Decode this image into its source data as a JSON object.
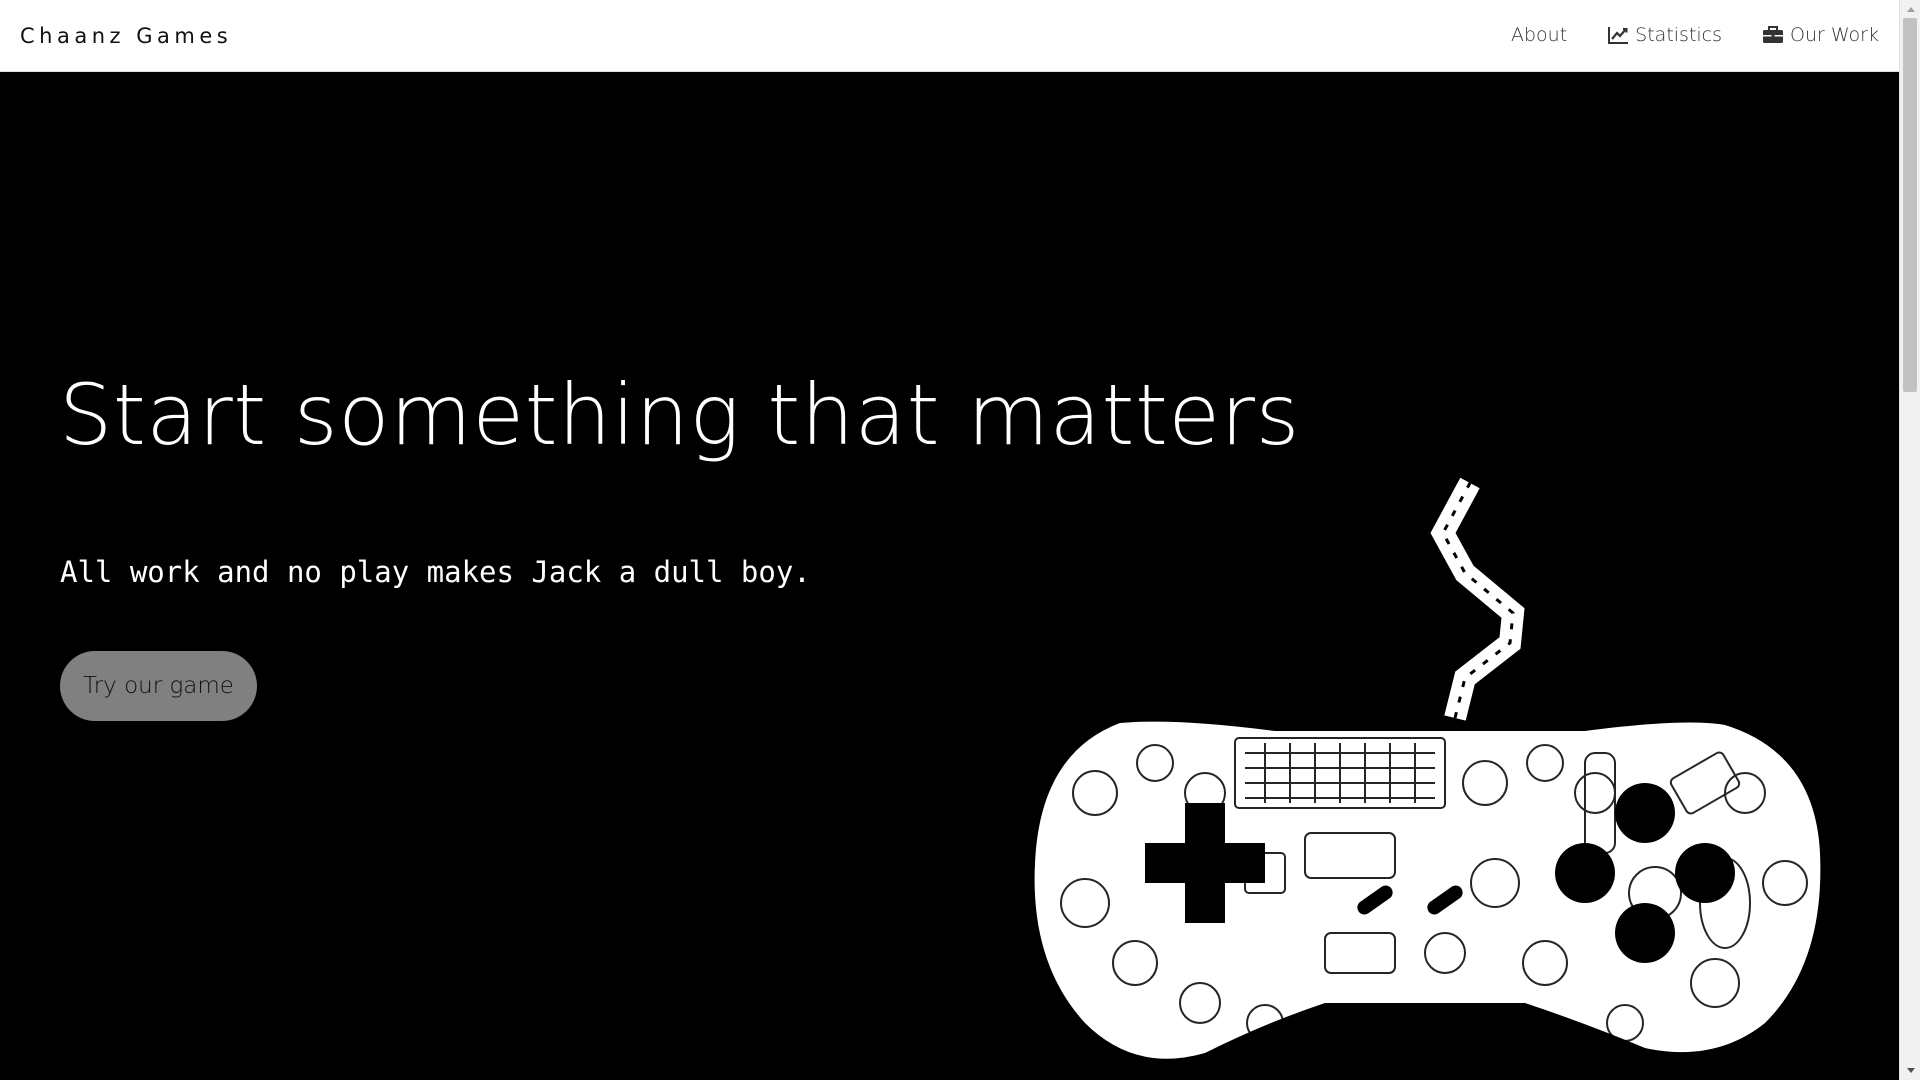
{
  "navbar": {
    "brand": "Chaanz Games",
    "items": [
      {
        "label": "About",
        "icon": ""
      },
      {
        "label": "Statistics",
        "icon": "line-chart-icon"
      },
      {
        "label": "Our Work",
        "icon": "briefcase-icon"
      }
    ]
  },
  "hero": {
    "title": "Start something that matters",
    "subtitle": "All work and no play makes Jack a dull boy.",
    "cta_label": "Try our game",
    "image": "gamepad-collage-illustration"
  },
  "colors": {
    "nav_bg": "#ffffff",
    "hero_bg": "#000000",
    "cta_bg": "#808080",
    "hero_text": "#ffffff"
  }
}
